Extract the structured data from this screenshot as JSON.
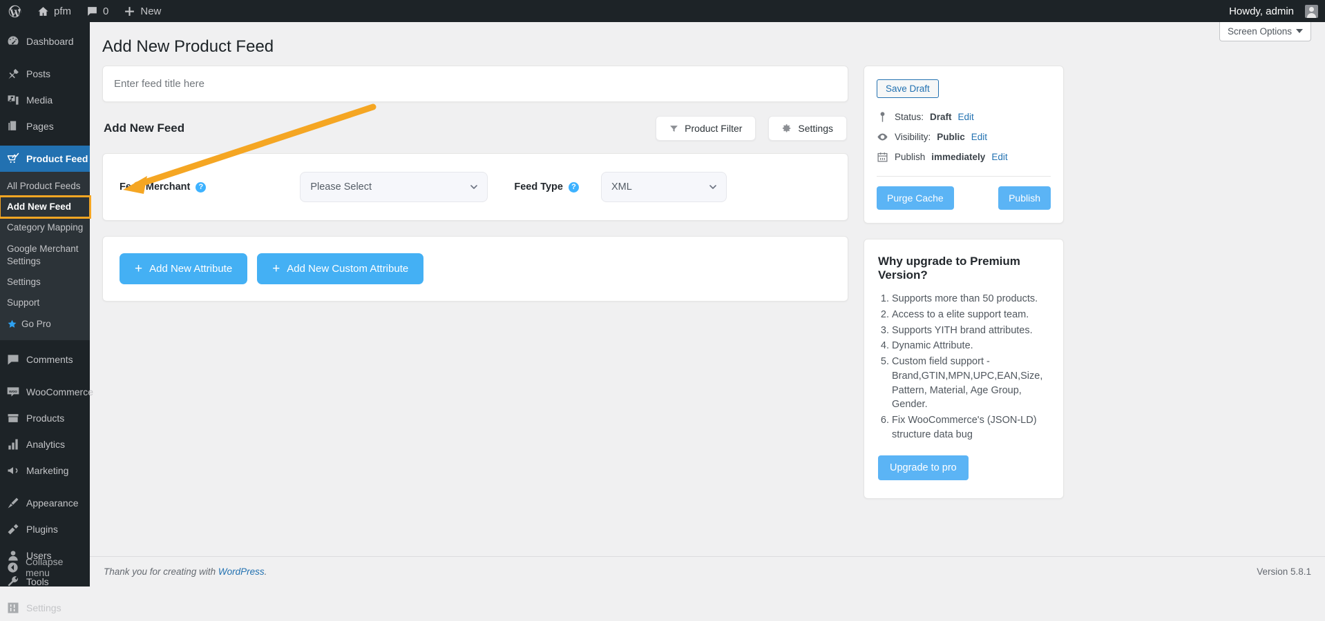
{
  "adminbar": {
    "logo_icon": "wordpress-logo-icon",
    "site_icon": "home-icon",
    "site_name": "pfm",
    "comments_icon": "comment-bubble-icon",
    "comments_count": "0",
    "new_icon": "plus-icon",
    "new_label": "New",
    "howdy": "Howdy, admin",
    "avatar_icon": "avatar-icon"
  },
  "sidebar": {
    "items": [
      {
        "label": "Dashboard",
        "icon": "dashboard-icon",
        "active": false
      },
      {
        "label": "Posts",
        "icon": "pin-icon",
        "active": false
      },
      {
        "label": "Media",
        "icon": "media-icon",
        "active": false
      },
      {
        "label": "Pages",
        "icon": "pages-icon",
        "active": false
      },
      {
        "label": "Product Feed",
        "icon": "chart-cart-icon",
        "active": true
      },
      {
        "label": "Comments",
        "icon": "comment-bubble-icon",
        "active": false
      },
      {
        "label": "WooCommerce",
        "icon": "woocommerce-icon",
        "active": false
      },
      {
        "label": "Products",
        "icon": "products-box-icon",
        "active": false
      },
      {
        "label": "Analytics",
        "icon": "bar-chart-icon",
        "active": false
      },
      {
        "label": "Marketing",
        "icon": "megaphone-icon",
        "active": false
      },
      {
        "label": "Appearance",
        "icon": "paintbrush-icon",
        "active": false
      },
      {
        "label": "Plugins",
        "icon": "plug-icon",
        "active": false
      },
      {
        "label": "Users",
        "icon": "user-icon",
        "active": false
      },
      {
        "label": "Tools",
        "icon": "wrench-icon",
        "active": false
      },
      {
        "label": "Settings",
        "icon": "sliders-icon",
        "active": false
      }
    ],
    "submenu": [
      {
        "label": "All Product Feeds",
        "highlighted": false
      },
      {
        "label": "Add New Feed",
        "highlighted": true
      },
      {
        "label": "Category Mapping",
        "highlighted": false
      },
      {
        "label": "Google Merchant Settings",
        "highlighted": false
      },
      {
        "label": "Settings",
        "highlighted": false
      },
      {
        "label": "Support",
        "highlighted": false
      },
      {
        "label": "Go Pro",
        "highlighted": false,
        "icon": "star-icon"
      }
    ],
    "collapse_label": "Collapse menu",
    "collapse_icon": "collapse-arrow-icon",
    "active_color": "#2271b1",
    "highlight_color": "#f5a623"
  },
  "screen_options": {
    "label": "Screen Options",
    "chevron_icon": "chevron-down-icon"
  },
  "page": {
    "title": "Add New Product Feed"
  },
  "feed_title_field": {
    "placeholder": "Enter feed title here",
    "value": ""
  },
  "feed_section": {
    "heading": "Add New Feed",
    "product_filter_label": "Product Filter",
    "product_filter_icon": "funnel-icon",
    "settings_label": "Settings",
    "settings_icon": "gear-icon"
  },
  "form": {
    "merchant_label": "Feed Merchant",
    "merchant_help_icon": "help-icon",
    "merchant_value": "Please Select",
    "type_label": "Feed Type",
    "type_help_icon": "help-icon",
    "type_value": "XML",
    "chevron_icon": "chevron-down-icon"
  },
  "attributes": {
    "add_attribute_label": "Add New Attribute",
    "add_custom_attribute_label": "Add New Custom Attribute",
    "plus_icon": "plus-icon",
    "button_color": "#44b0f4"
  },
  "publish_box": {
    "save_draft_label": "Save Draft",
    "status_icon": "pin-marker-icon",
    "status_prefix": "Status:",
    "status_value": "Draft",
    "status_edit": "Edit",
    "visibility_icon": "eye-icon",
    "visibility_prefix": "Visibility:",
    "visibility_value": "Public",
    "visibility_edit": "Edit",
    "schedule_icon": "calendar-icon",
    "schedule_prefix": "Publish",
    "schedule_value": "immediately",
    "schedule_edit": "Edit",
    "purge_cache_label": "Purge Cache",
    "publish_label": "Publish"
  },
  "premium": {
    "heading": "Why upgrade to Premium Version?",
    "features": [
      "Supports more than 50 products.",
      "Access to a elite support team.",
      "Supports YITH brand attributes.",
      "Dynamic Attribute.",
      "Custom field support - Brand,GTIN,MPN,UPC,EAN,Size, Pattern, Material, Age Group, Gender.",
      "Fix WooCommerce's (JSON-LD) structure data bug"
    ],
    "upgrade_label": "Upgrade to pro"
  },
  "footer": {
    "thanks_prefix": "Thank you for creating with ",
    "wordpress_link": "WordPress",
    "thanks_suffix": ".",
    "version": "Version 5.8.1"
  }
}
